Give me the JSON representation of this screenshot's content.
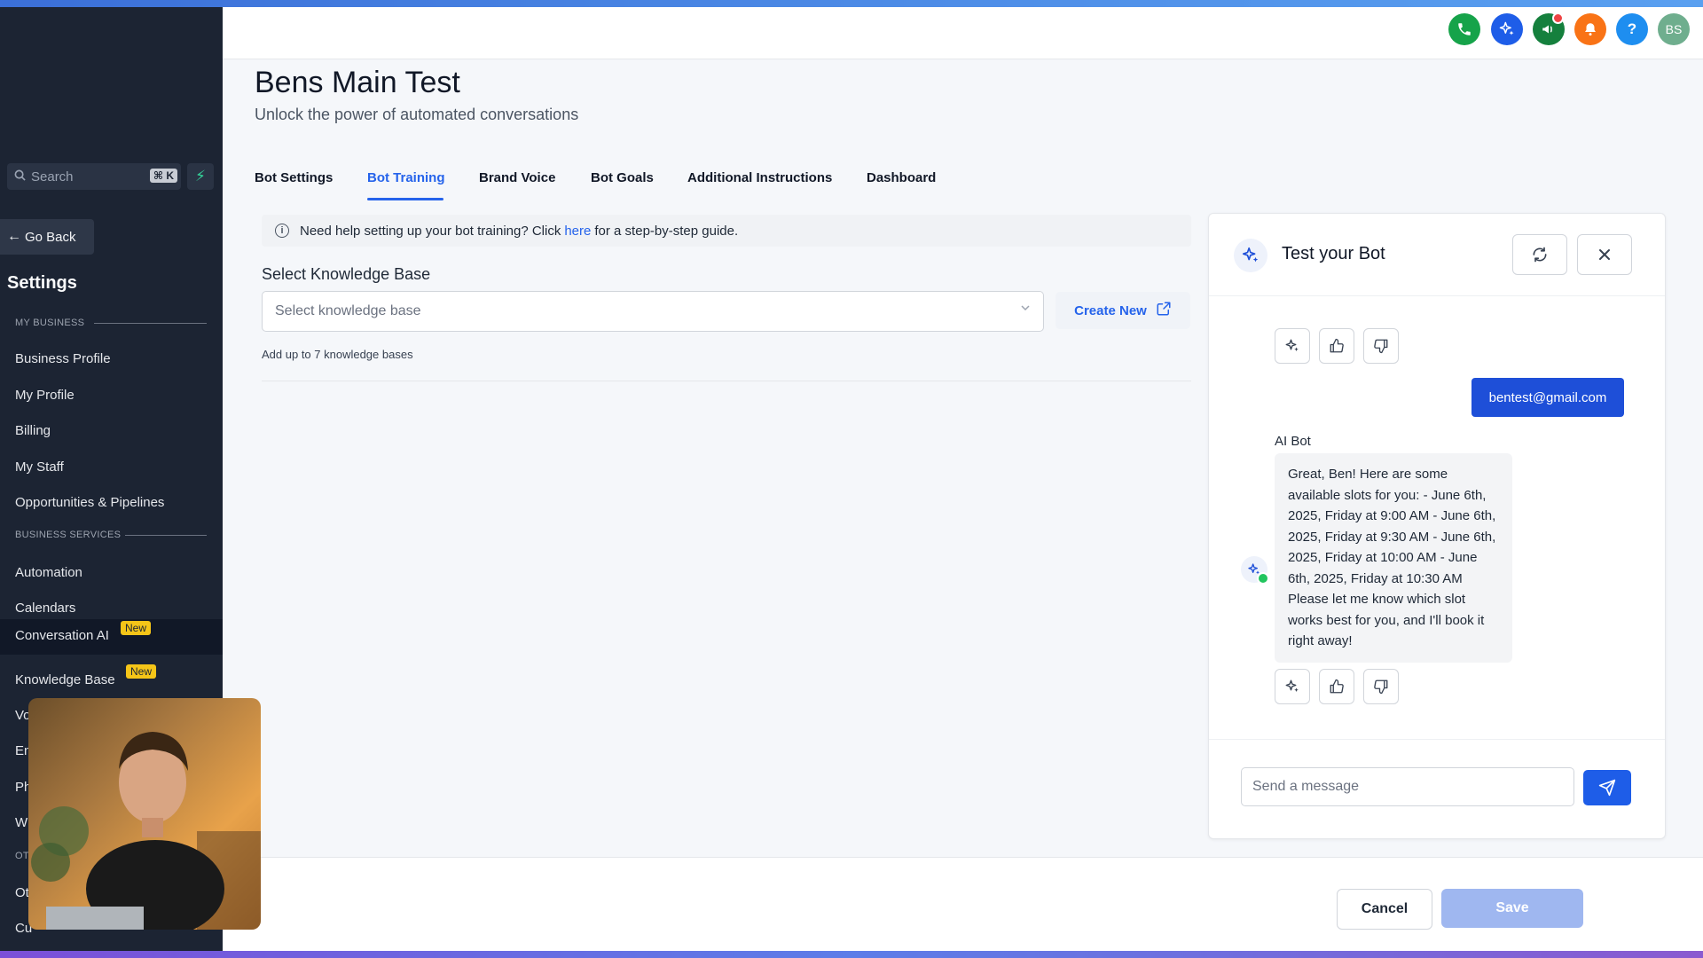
{
  "sidebar": {
    "search_placeholder": "Search",
    "search_shortcut": "⌘ K",
    "go_back": "Go Back",
    "heading": "Settings",
    "section_my_business": "MY BUSINESS",
    "section_business_services": "BUSINESS SERVICES",
    "section_other": "OT",
    "my_business_items": [
      {
        "label": "Business Profile"
      },
      {
        "label": "My Profile"
      },
      {
        "label": "Billing"
      },
      {
        "label": "My Staff"
      },
      {
        "label": "Opportunities & Pipelines"
      }
    ],
    "business_services_items": [
      {
        "label": "Automation"
      },
      {
        "label": "Calendars"
      },
      {
        "label": "Conversation AI",
        "badge": "New"
      },
      {
        "label": "Knowledge Base",
        "badge": "New"
      }
    ],
    "partially_hidden_items": [
      "Vo",
      "En",
      "Ph",
      "W"
    ],
    "other_items": [
      "Ot",
      "Cu"
    ]
  },
  "topbar": {
    "avatar_initials": "BS"
  },
  "page": {
    "title": "Bens Main Test",
    "subtitle": "Unlock the power of automated conversations"
  },
  "tabs": [
    {
      "label": "Bot Settings",
      "active": false
    },
    {
      "label": "Bot Training",
      "active": true
    },
    {
      "label": "Brand Voice",
      "active": false
    },
    {
      "label": "Bot Goals",
      "active": false
    },
    {
      "label": "Additional Instructions",
      "active": false
    },
    {
      "label": "Dashboard",
      "active": false
    }
  ],
  "training": {
    "help_prefix": "Need help setting up your bot training? Click",
    "help_link": "here",
    "help_suffix": "for a step-by-step guide.",
    "kb_label": "Select Knowledge Base",
    "kb_placeholder": "Select knowledge base",
    "create_new": "Create New",
    "kb_hint": "Add up to 7 knowledge bases"
  },
  "chat": {
    "title": "Test your Bot",
    "user_message": "bentest@gmail.com",
    "bot_name": "AI Bot",
    "bot_message": "Great, Ben! Here are some available slots for you: - June 6th, 2025, Friday at 9:00 AM - June 6th, 2025, Friday at 9:30 AM - June 6th, 2025, Friday at 10:00 AM - June 6th, 2025, Friday at 10:30 AM Please let me know which slot works best for you, and I'll book it right away!",
    "input_placeholder": "Send a message"
  },
  "footer": {
    "cancel": "Cancel",
    "save": "Save"
  },
  "colors": {
    "sidebar_bg": "#1c2433",
    "accent_blue": "#2563eb",
    "user_bubble": "#1e4fd8",
    "save_disabled": "#9fb7f0",
    "badge_new": "#f5c518",
    "online_status": "#22c55e"
  }
}
